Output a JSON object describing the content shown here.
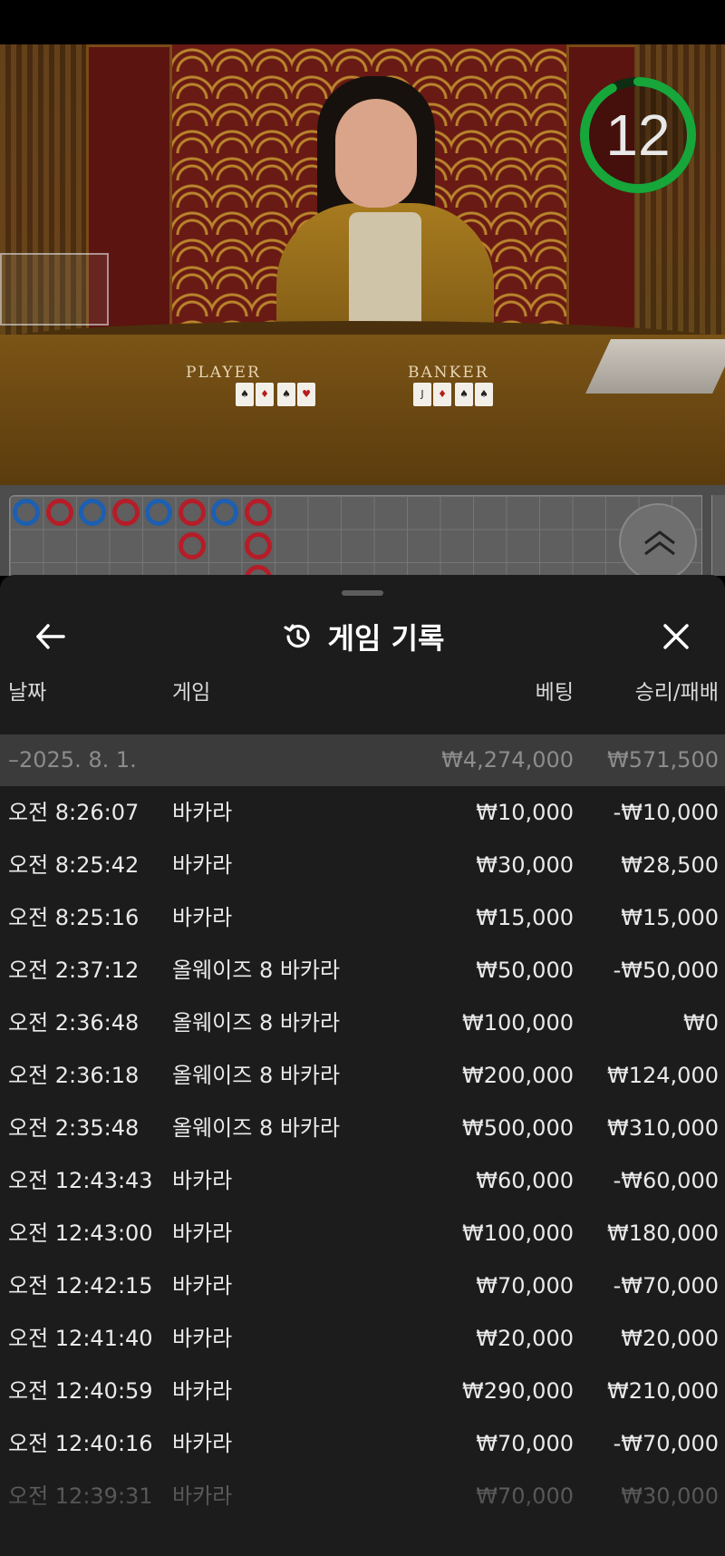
{
  "video": {
    "countdown": "12",
    "countdown_fraction": 0.92,
    "player_label": "PLAYER",
    "banker_label": "BANKER",
    "player_cards": [
      "♠",
      "♦",
      "♠",
      "♥"
    ],
    "banker_cards": [
      "J",
      "♦",
      "♠",
      "♠"
    ]
  },
  "roadmap": {
    "beads": [
      {
        "col": 0,
        "row": 0,
        "color": "blue"
      },
      {
        "col": 1,
        "row": 0,
        "color": "red"
      },
      {
        "col": 2,
        "row": 0,
        "color": "blue"
      },
      {
        "col": 3,
        "row": 0,
        "color": "red"
      },
      {
        "col": 4,
        "row": 0,
        "color": "blue"
      },
      {
        "col": 5,
        "row": 0,
        "color": "red"
      },
      {
        "col": 5,
        "row": 1,
        "color": "red"
      },
      {
        "col": 6,
        "row": 0,
        "color": "blue"
      },
      {
        "col": 7,
        "row": 0,
        "color": "red"
      },
      {
        "col": 7,
        "row": 1,
        "color": "red"
      },
      {
        "col": 7,
        "row": 2,
        "color": "red"
      }
    ],
    "expand_icon": "double-chevron-up-icon"
  },
  "sheet": {
    "title": "게임 기록",
    "back_icon": "arrow-left-icon",
    "history_icon": "history-icon",
    "close_icon": "close-icon",
    "columns": {
      "date": "날짜",
      "game": "게임",
      "bet": "베팅",
      "win_loss": "승리/패배"
    },
    "group": {
      "date": "–2025. 8. 1.",
      "bet": "₩4,274,000",
      "win_loss": "₩571,500"
    },
    "rows": [
      {
        "time": "오전 8:26:07",
        "game": "바카라",
        "bet": "₩10,000",
        "result": "-₩10,000"
      },
      {
        "time": "오전 8:25:42",
        "game": "바카라",
        "bet": "₩30,000",
        "result": "₩28,500"
      },
      {
        "time": "오전 8:25:16",
        "game": "바카라",
        "bet": "₩15,000",
        "result": "₩15,000"
      },
      {
        "time": "오전 2:37:12",
        "game": "올웨이즈 8 바카라",
        "bet": "₩50,000",
        "result": "-₩50,000"
      },
      {
        "time": "오전 2:36:48",
        "game": "올웨이즈 8 바카라",
        "bet": "₩100,000",
        "result": "₩0"
      },
      {
        "time": "오전 2:36:18",
        "game": "올웨이즈 8 바카라",
        "bet": "₩200,000",
        "result": "₩124,000"
      },
      {
        "time": "오전 2:35:48",
        "game": "올웨이즈 8 바카라",
        "bet": "₩500,000",
        "result": "₩310,000"
      },
      {
        "time": "오전 12:43:43",
        "game": "바카라",
        "bet": "₩60,000",
        "result": "-₩60,000"
      },
      {
        "time": "오전 12:43:00",
        "game": "바카라",
        "bet": "₩100,000",
        "result": "₩180,000"
      },
      {
        "time": "오전 12:42:15",
        "game": "바카라",
        "bet": "₩70,000",
        "result": "-₩70,000"
      },
      {
        "time": "오전 12:41:40",
        "game": "바카라",
        "bet": "₩20,000",
        "result": "₩20,000"
      },
      {
        "time": "오전 12:40:59",
        "game": "바카라",
        "bet": "₩290,000",
        "result": "₩210,000"
      },
      {
        "time": "오전 12:40:16",
        "game": "바카라",
        "bet": "₩70,000",
        "result": "-₩70,000"
      },
      {
        "time": "오전 12:39:31",
        "game": "바카라",
        "bet": "₩70,000",
        "result": "₩30,000"
      }
    ]
  },
  "colors": {
    "bead_blue": "#1d5fb0",
    "bead_red": "#b51d28",
    "timer_green": "#17a63a",
    "sheet_bg": "#1c1c1c",
    "group_bg": "#3b3b3b"
  }
}
